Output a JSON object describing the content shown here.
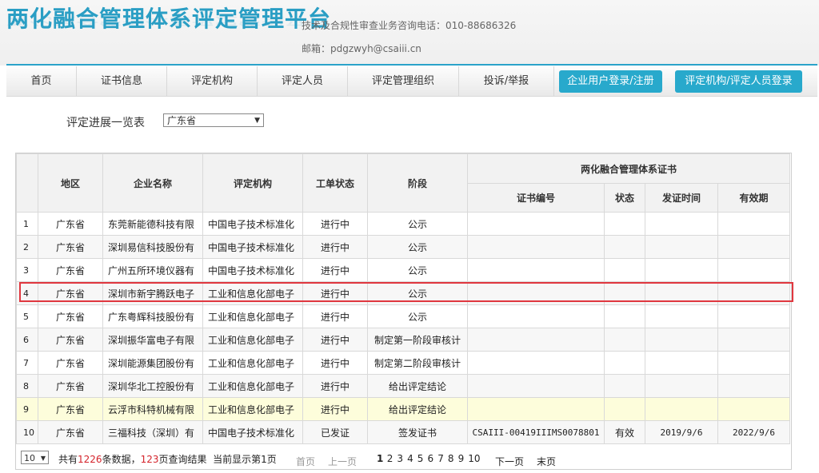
{
  "header": {
    "title": "两化融合管理体系评定管理平台",
    "hotline": "技术及合规性审查业务咨询电话：010-88686326",
    "email": "邮箱：pdgzwyh@csaiii.cn"
  },
  "nav": {
    "items": [
      "首页",
      "证书信息",
      "评定机构",
      "评定人员",
      "评定管理组织",
      "投诉/举报"
    ],
    "enterprise_login": "企业用户登录/注册",
    "agency_login": "评定机构/评定人员登录"
  },
  "filter": {
    "label": "评定进展一览表",
    "province": "广东省"
  },
  "table": {
    "headers": {
      "region": "地区",
      "company": "企业名称",
      "agency": "评定机构",
      "status": "工单状态",
      "stage": "阶段",
      "cert_group": "两化融合管理体系证书",
      "cert_no": "证书编号",
      "cert_status": "状态",
      "issue_date": "发证时间",
      "valid_until": "有效期"
    },
    "rows": [
      {
        "idx": "1",
        "region": "广东省",
        "company": "东莞新能德科技有限",
        "agency": "中国电子技术标准化",
        "status": "进行中",
        "stage": "公示",
        "cert_no": "",
        "cert_status": "",
        "issue_date": "",
        "valid_until": ""
      },
      {
        "idx": "2",
        "region": "广东省",
        "company": "深圳易信科技股份有",
        "agency": "中国电子技术标准化",
        "status": "进行中",
        "stage": "公示",
        "cert_no": "",
        "cert_status": "",
        "issue_date": "",
        "valid_until": ""
      },
      {
        "idx": "3",
        "region": "广东省",
        "company": "广州五所环境仪器有",
        "agency": "中国电子技术标准化",
        "status": "进行中",
        "stage": "公示",
        "cert_no": "",
        "cert_status": "",
        "issue_date": "",
        "valid_until": ""
      },
      {
        "idx": "4",
        "region": "广东省",
        "company": "深圳市新宇腾跃电子",
        "agency": "工业和信息化部电子",
        "status": "进行中",
        "stage": "公示",
        "cert_no": "",
        "cert_status": "",
        "issue_date": "",
        "valid_until": ""
      },
      {
        "idx": "5",
        "region": "广东省",
        "company": "广东粤辉科技股份有",
        "agency": "工业和信息化部电子",
        "status": "进行中",
        "stage": "公示",
        "cert_no": "",
        "cert_status": "",
        "issue_date": "",
        "valid_until": ""
      },
      {
        "idx": "6",
        "region": "广东省",
        "company": "深圳振华富电子有限",
        "agency": "工业和信息化部电子",
        "status": "进行中",
        "stage": "制定第一阶段审核计",
        "cert_no": "",
        "cert_status": "",
        "issue_date": "",
        "valid_until": ""
      },
      {
        "idx": "7",
        "region": "广东省",
        "company": "深圳能源集团股份有",
        "agency": "工业和信息化部电子",
        "status": "进行中",
        "stage": "制定第二阶段审核计",
        "cert_no": "",
        "cert_status": "",
        "issue_date": "",
        "valid_until": ""
      },
      {
        "idx": "8",
        "region": "广东省",
        "company": "深圳华北工控股份有",
        "agency": "工业和信息化部电子",
        "status": "进行中",
        "stage": "给出评定结论",
        "cert_no": "",
        "cert_status": "",
        "issue_date": "",
        "valid_until": ""
      },
      {
        "idx": "9",
        "region": "广东省",
        "company": "云浮市科特机械有限",
        "agency": "工业和信息化部电子",
        "status": "进行中",
        "stage": "给出评定结论",
        "cert_no": "",
        "cert_status": "",
        "issue_date": "",
        "valid_until": ""
      },
      {
        "idx": "10",
        "region": "广东省",
        "company": "三福科技（深圳）有",
        "agency": "中国电子技术标准化",
        "status": "已发证",
        "stage": "签发证书",
        "cert_no": "CSAIII-00419IIIMS0078801",
        "cert_status": "有效",
        "issue_date": "2019/9/6",
        "valid_until": "2022/9/6"
      }
    ]
  },
  "pager": {
    "page_size": "10",
    "total_prefix": "共有",
    "total_count": "1226",
    "total_mid": "条数据，",
    "total_pages": "123",
    "total_suffix": "页查询结果",
    "current_prefix": "当前显示第",
    "current_page": "1",
    "current_suffix": "页",
    "first": "首页",
    "prev": "上一页",
    "pages": [
      "1",
      "2",
      "3",
      "4",
      "5",
      "6",
      "7",
      "8",
      "9",
      "10"
    ],
    "next": "下一页",
    "last": "末页"
  }
}
